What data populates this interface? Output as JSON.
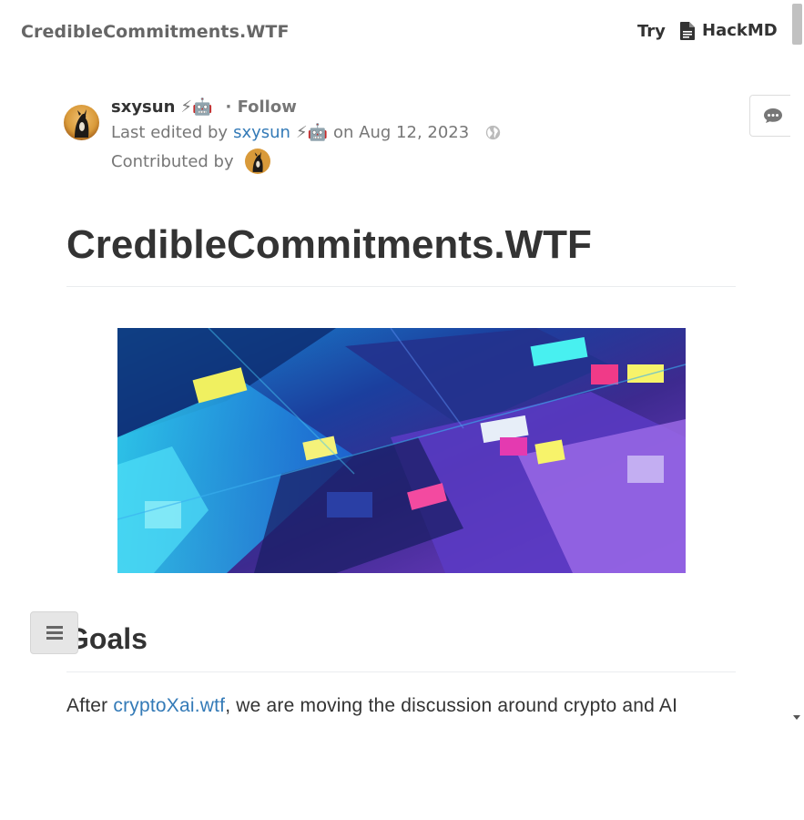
{
  "topbar": {
    "brand": "CredibleCommitments.WTF",
    "try_label": "Try",
    "hackmd_label": "HackMD"
  },
  "meta": {
    "author": "sxysun",
    "author_emojis": "⚡🤖",
    "follow_label": "· Follow",
    "last_edited_prefix": "Last edited by",
    "last_edited_user": "sxysun",
    "last_edited_emojis": "⚡🤖",
    "last_edited_suffix": "on Aug 12, 2023",
    "contributed_by_label": "Contributed by"
  },
  "doc": {
    "title": "CredibleCommitments.WTF",
    "section_heading": "Goals",
    "para_prefix": "After ",
    "para_link": "cryptoXai.wtf",
    "para_suffix": ", we are moving the discussion around crypto and AI"
  },
  "icons": {
    "document": "file-icon",
    "comment": "comment-icon",
    "globe": "globe-icon",
    "toc": "menu-icon"
  },
  "colors": {
    "link": "#337ab7",
    "muted": "#777777",
    "text": "#333333"
  }
}
